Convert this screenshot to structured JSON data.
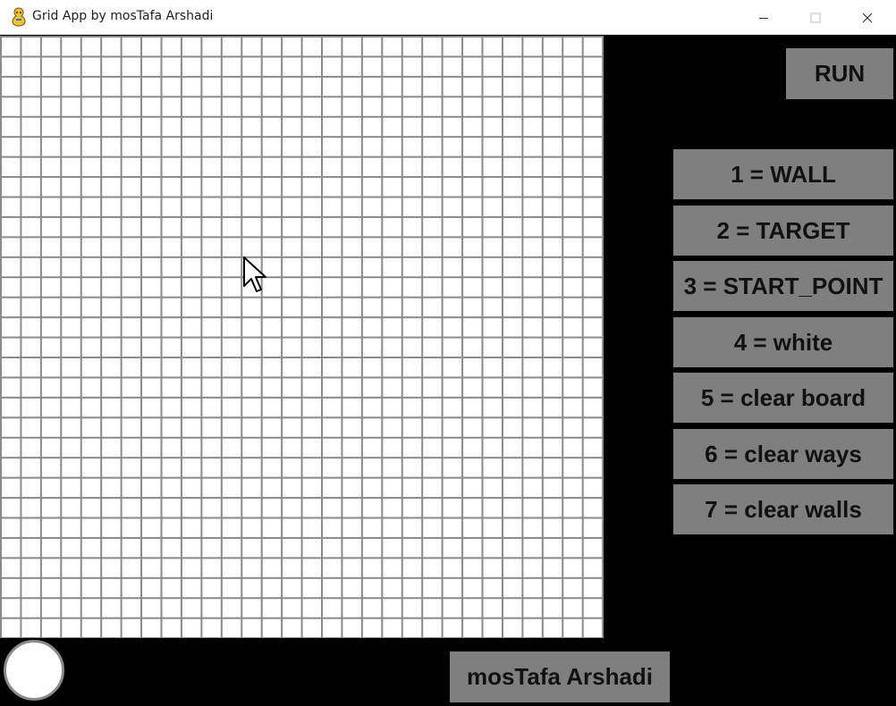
{
  "window": {
    "title": "Grid App by mosTafa Arshadi",
    "app_icon": "pygame-snake-icon",
    "controls": [
      "minimize-icon",
      "maximize-icon",
      "close-icon"
    ]
  },
  "grid": {
    "columns": 30,
    "rows": 30,
    "cell_color": "#ffffff",
    "line_color": "#8a8a8a"
  },
  "toolbar": {
    "run_label": "RUN"
  },
  "legend": {
    "items": [
      {
        "label": "1 = WALL"
      },
      {
        "label": "2 = TARGET"
      },
      {
        "label": "3 = START_POINT"
      },
      {
        "label": "4 = white"
      },
      {
        "label": "5 = clear board"
      },
      {
        "label": "6 = clear ways"
      },
      {
        "label": "7 = clear walls"
      }
    ]
  },
  "footer": {
    "author_label": "mosTafa Arshadi",
    "indicator": "status-circle"
  },
  "colors": {
    "background": "#000000",
    "button": "#7f7f7f",
    "button_text": "#111111"
  }
}
